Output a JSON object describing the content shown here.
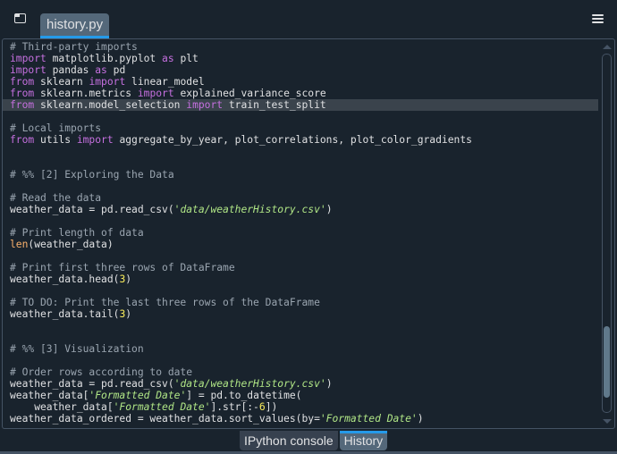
{
  "topbar": {
    "undock_icon": "undock-window-icon",
    "file_tab": "history.py",
    "options_icon": "hamburger-menu-icon"
  },
  "editor": {
    "lines": [
      [
        {
          "t": "# Third-party imports",
          "c": "cm"
        }
      ],
      [
        {
          "t": "import",
          "c": "kw"
        },
        {
          "t": " matplotlib.pyplot "
        },
        {
          "t": "as",
          "c": "kw"
        },
        {
          "t": " plt"
        }
      ],
      [
        {
          "t": "import",
          "c": "kw"
        },
        {
          "t": " pandas "
        },
        {
          "t": "as",
          "c": "kw"
        },
        {
          "t": " pd"
        }
      ],
      [
        {
          "t": "from",
          "c": "kw"
        },
        {
          "t": " sklearn "
        },
        {
          "t": "import",
          "c": "kw"
        },
        {
          "t": " linear_model"
        }
      ],
      [
        {
          "t": "from",
          "c": "kw"
        },
        {
          "t": " sklearn.metrics "
        },
        {
          "t": "import",
          "c": "kw"
        },
        {
          "t": " explained_variance_score"
        }
      ],
      [
        {
          "t": "from",
          "c": "kw"
        },
        {
          "t": " sklearn.model_selection "
        },
        {
          "t": "import",
          "c": "kw"
        },
        {
          "t": " train_test_split"
        }
      ],
      [],
      [
        {
          "t": "# Local imports",
          "c": "cm"
        }
      ],
      [
        {
          "t": "from",
          "c": "kw"
        },
        {
          "t": " utils "
        },
        {
          "t": "import",
          "c": "kw"
        },
        {
          "t": " aggregate_by_year, plot_correlations, plot_color_gradients"
        }
      ],
      [],
      [],
      [
        {
          "t": "# %% [2] Exploring the Data",
          "c": "cm"
        }
      ],
      [],
      [
        {
          "t": "# Read the data",
          "c": "cm"
        }
      ],
      [
        {
          "t": "weather_data = pd.read_csv("
        },
        {
          "t": "'data/weatherHistory.csv'",
          "c": "st"
        },
        {
          "t": ")"
        }
      ],
      [],
      [
        {
          "t": "# Print length of data",
          "c": "cm"
        }
      ],
      [
        {
          "t": "len",
          "c": "bi"
        },
        {
          "t": "(weather_data)"
        }
      ],
      [],
      [
        {
          "t": "# Print first three rows of DataFrame",
          "c": "cm"
        }
      ],
      [
        {
          "t": "weather_data.head("
        },
        {
          "t": "3",
          "c": "nm"
        },
        {
          "t": ")"
        }
      ],
      [],
      [
        {
          "t": "# TO DO: Print the last three rows of the DataFrame",
          "c": "cm"
        }
      ],
      [
        {
          "t": "weather_data.tail("
        },
        {
          "t": "3",
          "c": "nm"
        },
        {
          "t": ")"
        }
      ],
      [],
      [],
      [
        {
          "t": "# %% [3] Visualization",
          "c": "cm"
        }
      ],
      [],
      [
        {
          "t": "# Order rows according to date",
          "c": "cm"
        }
      ],
      [
        {
          "t": "weather_data = pd.read_csv("
        },
        {
          "t": "'data/weatherHistory.csv'",
          "c": "st"
        },
        {
          "t": ")"
        }
      ],
      [
        {
          "t": "weather_data["
        },
        {
          "t": "'Formatted Date'",
          "c": "st"
        },
        {
          "t": "] = pd.to_datetime("
        }
      ],
      [
        {
          "t": "    weather_data["
        },
        {
          "t": "'Formatted Date'",
          "c": "st"
        },
        {
          "t": "].str[:-"
        },
        {
          "t": "6",
          "c": "nm"
        },
        {
          "t": "])"
        }
      ],
      [
        {
          "t": "weather_data_ordered = weather_data.sort_values(by="
        },
        {
          "t": "'Formatted Date'",
          "c": "st"
        },
        {
          "t": ")"
        }
      ]
    ],
    "highlighted_line": 5,
    "scrollbar": {
      "thumb_start": 0.76,
      "thumb_end": 0.96
    }
  },
  "bottom_tabs": [
    {
      "label": "IPython console",
      "active": false
    },
    {
      "label": "History",
      "active": true
    }
  ]
}
